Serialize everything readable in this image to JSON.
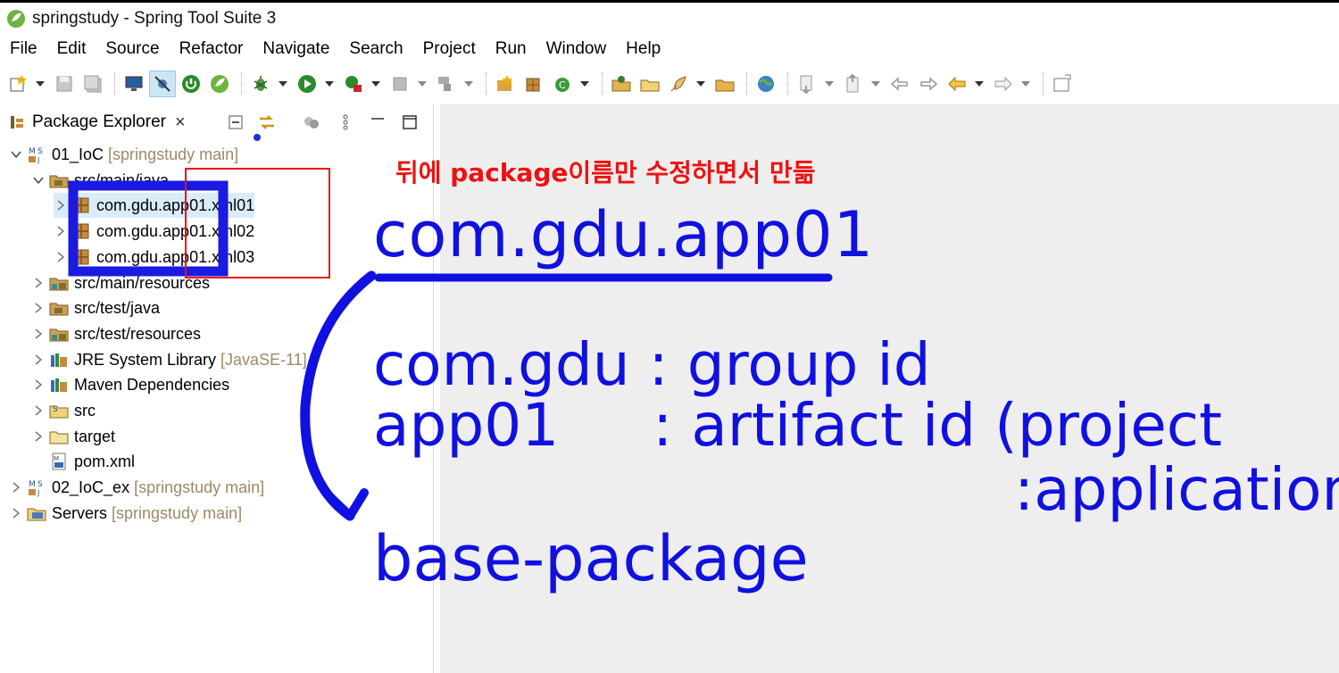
{
  "window": {
    "title": "springstudy - Spring Tool Suite 3"
  },
  "menu": [
    "File",
    "Edit",
    "Source",
    "Refactor",
    "Navigate",
    "Search",
    "Project",
    "Run",
    "Window",
    "Help"
  ],
  "package_explorer": {
    "title": "Package Explorer",
    "close_label": "×",
    "tree": [
      {
        "name": "01_IoC",
        "decor": "[springstudy main]",
        "icon": "maven-project-icon",
        "expanded": true,
        "depth": 0
      },
      {
        "name": "src/main/java",
        "decor": "",
        "icon": "source-folder-icon",
        "expanded": true,
        "depth": 1
      },
      {
        "name": "com.gdu.app01.xml01",
        "decor": "",
        "icon": "package-icon",
        "expanded": false,
        "depth": 2,
        "selected": true
      },
      {
        "name": "com.gdu.app01.xml02",
        "decor": "",
        "icon": "package-icon",
        "expanded": false,
        "depth": 2
      },
      {
        "name": "com.gdu.app01.xml03",
        "decor": "",
        "icon": "package-icon",
        "expanded": false,
        "depth": 2
      },
      {
        "name": "src/main/resources",
        "decor": "",
        "icon": "resource-folder-icon",
        "expanded": false,
        "depth": 1
      },
      {
        "name": "src/test/java",
        "decor": "",
        "icon": "source-folder-icon",
        "expanded": false,
        "depth": 1
      },
      {
        "name": "src/test/resources",
        "decor": "",
        "icon": "resource-folder-icon",
        "expanded": false,
        "depth": 1
      },
      {
        "name": "JRE System Library",
        "decor": "[JavaSE-11]",
        "icon": "library-icon",
        "expanded": false,
        "depth": 1
      },
      {
        "name": "Maven Dependencies",
        "decor": "",
        "icon": "library-icon",
        "expanded": false,
        "depth": 1
      },
      {
        "name": "src",
        "decor": "",
        "icon": "src-folder-icon",
        "expanded": false,
        "depth": 1
      },
      {
        "name": "target",
        "decor": "",
        "icon": "folder-icon",
        "expanded": false,
        "depth": 1
      },
      {
        "name": "pom.xml",
        "decor": "",
        "icon": "xml-file-icon",
        "expanded": null,
        "depth": 1
      },
      {
        "name": "02_IoC_ex",
        "decor": "[springstudy main]",
        "icon": "maven-project-icon",
        "expanded": false,
        "depth": 0
      },
      {
        "name": "Servers",
        "decor": "[springstudy main]",
        "icon": "servers-folder-icon",
        "expanded": false,
        "depth": 0
      }
    ]
  },
  "annotations": {
    "red_note": "뒤에 package이름만 수정하면서 만듦",
    "package_example": "com.gdu.app01",
    "group_line": "com.gdu : group id",
    "artifact_line": "app01     : artifact id (project",
    "application_line": ":application",
    "base_package": "base-package"
  },
  "colors": {
    "annotation_blue": "#1010e0",
    "annotation_red": "#ee1111",
    "selection": "#d9ecfa",
    "editor_bg": "#eeeeee"
  }
}
